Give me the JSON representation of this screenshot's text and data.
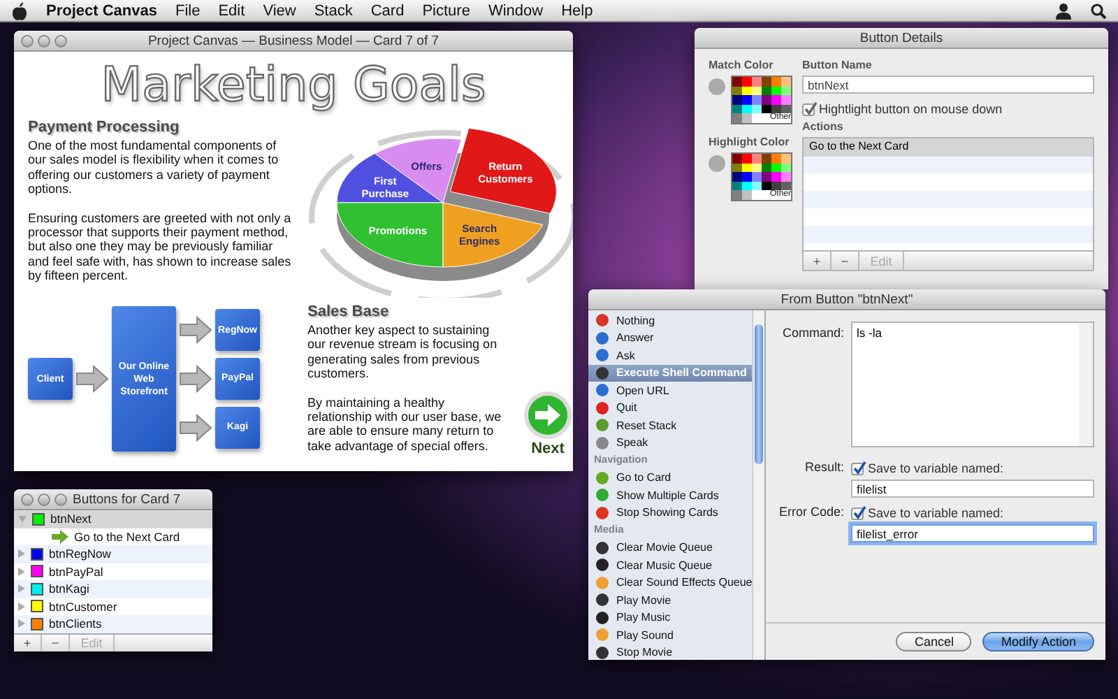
{
  "menu_bar": {
    "app": "Project Canvas",
    "items": [
      "File",
      "Edit",
      "View",
      "Stack",
      "Card",
      "Picture",
      "Window",
      "Help"
    ]
  },
  "card_window": {
    "title": "Project Canvas — Business Model — Card 7 of 7",
    "heading": "Marketing Goals",
    "sections": [
      {
        "title": "Payment Processing",
        "paragraphs": [
          "One of the most fundamental components of our sales model is flexibility when it comes to offering our customers a variety of payment options.",
          "Ensuring customers are greeted with not only a processor that supports their payment method, but also one they may be previously familiar and feel safe with, has shown to increase sales by fifteen percent."
        ]
      },
      {
        "title": "Sales Base",
        "paragraphs": [
          "Another key aspect to sustaining our revenue stream is focusing on generating sales from previous customers.",
          "By maintaining a healthy relationship with our user base, we are able to ensure many return to take advantage of special offers."
        ]
      }
    ],
    "pie_labels": [
      {
        "label": "Offers",
        "color": "#d98cf0",
        "exploded": false
      },
      {
        "label": "First Purchase",
        "color": "#5050e0",
        "exploded": false
      },
      {
        "label": "Return Customers",
        "color": "#e01818",
        "exploded": true
      },
      {
        "label": "Promotions",
        "color": "#30c030",
        "exploded": false
      },
      {
        "label": "Search Engines",
        "color": "#f0a020",
        "exploded": false
      }
    ],
    "flow": {
      "source": "Client",
      "hub": "Our Online Web Storefront",
      "targets": [
        "RegNow",
        "PayPal",
        "Kagi"
      ]
    },
    "next_button": "Next"
  },
  "buttons_palette": {
    "title": "Buttons for Card 7",
    "items": [
      {
        "name": "btnNext",
        "color": "#00ee00",
        "expanded": true,
        "selected": true,
        "children": [
          {
            "name": "Go to the Next Card"
          }
        ]
      },
      {
        "name": "btnRegNow",
        "color": "#0000ee",
        "expanded": false,
        "selected": false
      },
      {
        "name": "btnPayPal",
        "color": "#ff00ee",
        "expanded": false,
        "selected": false
      },
      {
        "name": "btnKagi",
        "color": "#00eeee",
        "expanded": false,
        "selected": false
      },
      {
        "name": "btnCustomer",
        "color": "#ffff00",
        "expanded": false,
        "selected": false
      },
      {
        "name": "btnClients",
        "color": "#ff8000",
        "expanded": false,
        "selected": false
      }
    ],
    "toolbar": [
      {
        "label": "+",
        "disabled": false
      },
      {
        "label": "−",
        "disabled": false
      },
      {
        "label": "Edit",
        "disabled": true
      }
    ]
  },
  "button_details": {
    "title": "Button Details",
    "match_color": {
      "label": "Match Color",
      "other": "Other",
      "swatches": [
        {
          "color": "#800000"
        },
        {
          "color": "#ff0000"
        },
        {
          "color": "#ff8080"
        },
        {
          "color": "#804000"
        },
        {
          "color": "#ff8000"
        },
        {
          "color": "#ffc080"
        },
        {
          "color": "#808000"
        },
        {
          "color": "#ffff00"
        },
        {
          "color": "#ffff80"
        },
        {
          "color": "#008000"
        },
        {
          "color": "#00ff00"
        },
        {
          "color": "#80ff80"
        },
        {
          "color": "#000080"
        },
        {
          "color": "#0000ff"
        },
        {
          "color": "#8080ff"
        },
        {
          "color": "#800080"
        },
        {
          "color": "#ff00ff"
        },
        {
          "color": "#ff80ff"
        },
        {
          "color": "#008080"
        },
        {
          "color": "#00ffff"
        },
        {
          "color": "#80ffff"
        },
        {
          "color": "#000000"
        },
        {
          "color": "#404040"
        },
        {
          "color": "#606060"
        },
        {
          "color": "#808080"
        },
        {
          "color": "#c0c0c0"
        },
        {
          "color": "#ffffff"
        }
      ]
    },
    "highlight_color": {
      "label": "Highlight Color",
      "other": "Other",
      "swatches": [
        {
          "color": "#800000"
        },
        {
          "color": "#ff0000"
        },
        {
          "color": "#ff8080"
        },
        {
          "color": "#804000"
        },
        {
          "color": "#ff8000"
        },
        {
          "color": "#ffc080"
        },
        {
          "color": "#808000"
        },
        {
          "color": "#ffff00"
        },
        {
          "color": "#ffff80"
        },
        {
          "color": "#008000"
        },
        {
          "color": "#00ff00"
        },
        {
          "color": "#80ff80"
        },
        {
          "color": "#000080"
        },
        {
          "color": "#0000ff"
        },
        {
          "color": "#8080ff"
        },
        {
          "color": "#800080"
        },
        {
          "color": "#ff00ff"
        },
        {
          "color": "#ff80ff"
        },
        {
          "color": "#008080"
        },
        {
          "color": "#00ffff"
        },
        {
          "color": "#80ffff"
        },
        {
          "color": "#000000"
        },
        {
          "color": "#404040"
        },
        {
          "color": "#606060"
        },
        {
          "color": "#808080"
        },
        {
          "color": "#c0c0c0"
        },
        {
          "color": "#ffffff"
        }
      ]
    },
    "button_name": {
      "label": "Button Name",
      "value": "btnNext"
    },
    "highlight_checkbox": {
      "label": "Hightlight button on mouse down",
      "checked": true
    },
    "actions": {
      "label": "Actions",
      "rows": [
        {
          "text": "Go to the Next Card",
          "selected": true
        }
      ]
    },
    "toolbar": [
      {
        "label": "+",
        "disabled": false
      },
      {
        "label": "−",
        "disabled": false
      },
      {
        "label": "Edit",
        "disabled": true
      }
    ]
  },
  "action_dialog": {
    "title": "From Button \"btnNext\"",
    "actions": [
      {
        "kind": "item",
        "label": "Nothing",
        "color": "#d9342b",
        "selected": false
      },
      {
        "kind": "item",
        "label": "Answer",
        "color": "#2a6fd0",
        "selected": false
      },
      {
        "kind": "item",
        "label": "Ask",
        "color": "#2a6fd0",
        "selected": false
      },
      {
        "kind": "item",
        "label": "Execute Shell Command",
        "color": "#333333",
        "selected": true
      },
      {
        "kind": "item",
        "label": "Open URL",
        "color": "#2a6fd0",
        "selected": false
      },
      {
        "kind": "item",
        "label": "Quit",
        "color": "#dd2222",
        "selected": false
      },
      {
        "kind": "item",
        "label": "Reset Stack",
        "color": "#5a9a2a",
        "selected": false
      },
      {
        "kind": "item",
        "label": "Speak",
        "color": "#888888",
        "selected": false
      },
      {
        "kind": "header",
        "label": "Navigation"
      },
      {
        "kind": "item",
        "label": "Go to Card",
        "color": "#66aa22",
        "selected": false
      },
      {
        "kind": "item",
        "label": "Show Multiple Cards",
        "color": "#33aa33",
        "selected": false
      },
      {
        "kind": "item",
        "label": "Stop Showing Cards",
        "color": "#dd3322",
        "selected": false
      },
      {
        "kind": "header",
        "label": "Media"
      },
      {
        "kind": "item",
        "label": "Clear Movie Queue",
        "color": "#333333",
        "selected": false
      },
      {
        "kind": "item",
        "label": "Clear Music Queue",
        "color": "#222222",
        "selected": false
      },
      {
        "kind": "item",
        "label": "Clear Sound Effects Queue",
        "color": "#f0a030",
        "selected": false
      },
      {
        "kind": "item",
        "label": "Play Movie",
        "color": "#333333",
        "selected": false
      },
      {
        "kind": "item",
        "label": "Play Music",
        "color": "#222222",
        "selected": false
      },
      {
        "kind": "item",
        "label": "Play Sound",
        "color": "#f0a030",
        "selected": false
      },
      {
        "kind": "item",
        "label": "Stop Movie",
        "color": "#333333",
        "selected": false
      }
    ],
    "command": {
      "label": "Command:",
      "value": "ls -la"
    },
    "result": {
      "label": "Result:",
      "checkbox": {
        "label": "Save to variable named:",
        "checked": true
      },
      "value": "filelist",
      "focused": false
    },
    "error_code": {
      "label": "Error Code:",
      "checkbox": {
        "label": "Save to variable named:",
        "checked": true
      },
      "value": "filelist_error",
      "focused": true
    },
    "buttons": [
      {
        "label": "Cancel",
        "default": false
      },
      {
        "label": "Modify Action",
        "default": true
      }
    ]
  }
}
